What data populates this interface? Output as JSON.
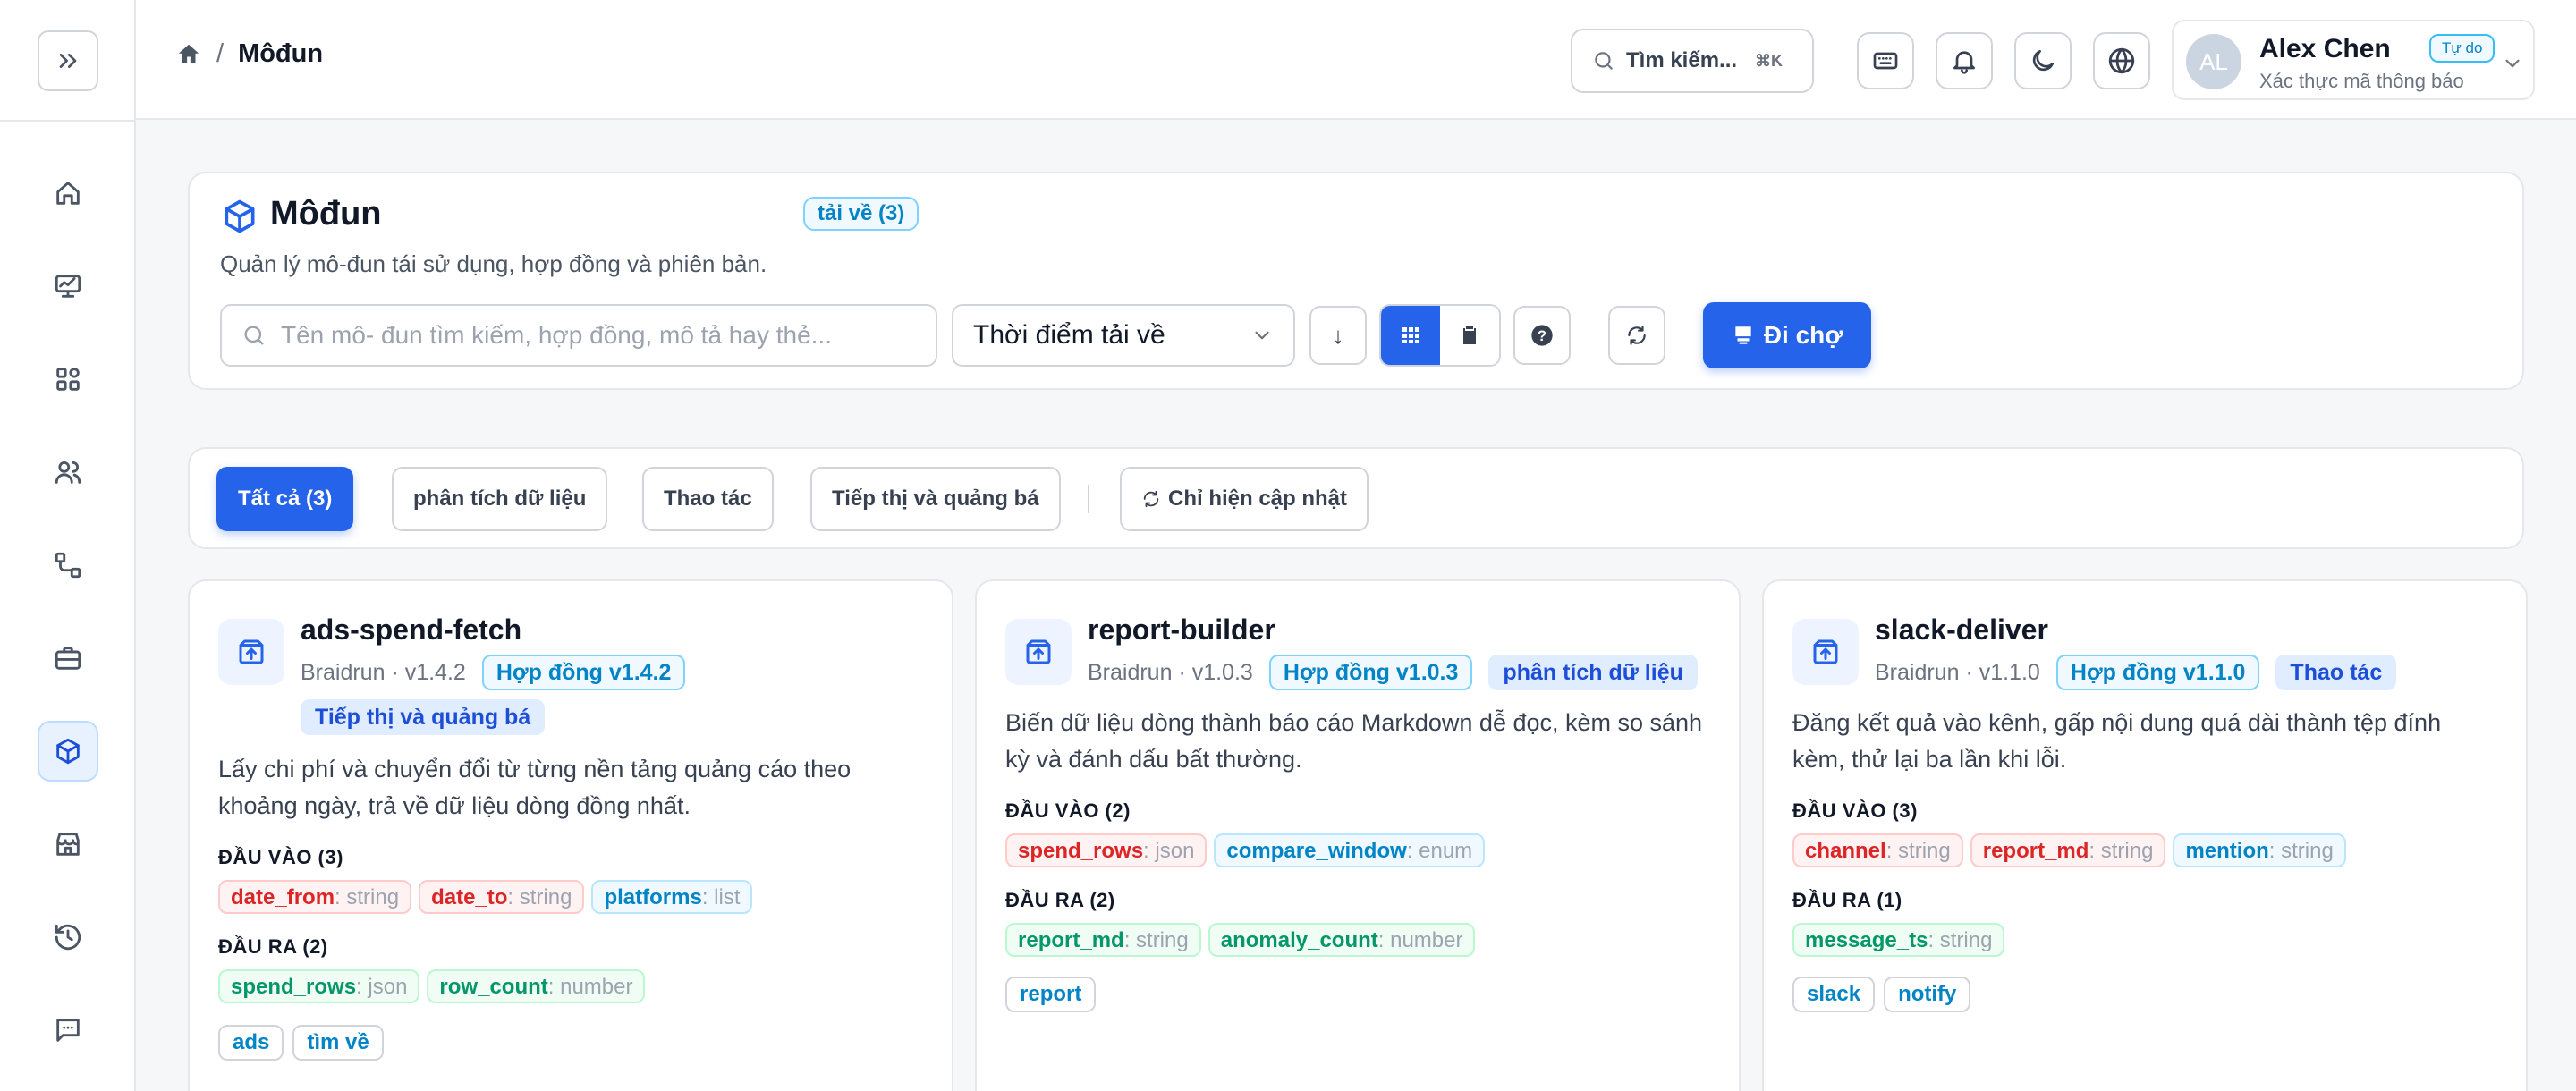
{
  "breadcrumb": {
    "current": "Môđun"
  },
  "topbar": {
    "search_label": "Tìm kiếm...",
    "search_shortcut": "⌘K",
    "icons": [
      "keyboard-icon",
      "bell-icon",
      "moon-icon",
      "globe-icon"
    ]
  },
  "user": {
    "initials": "AL",
    "name": "Alex Chen",
    "plan": "Tự do",
    "subtitle": "Xác thực mã thông báo"
  },
  "sidebar": {
    "items": [
      "home",
      "monitor",
      "apps",
      "users",
      "workflow",
      "briefcase",
      "modules",
      "store",
      "history",
      "messages"
    ],
    "active": "modules"
  },
  "header": {
    "title": "Môđun",
    "badge": "tải về (3)",
    "subtitle": "Quản lý mô-đun tái sử dụng, hợp đồng và phiên bản.",
    "search_placeholder": "Tên mô- đun tìm kiếm, hợp đồng, mô tả hay thẻ...",
    "sort_value": "Thời điểm tải về",
    "sort_dir_glyph": "↓",
    "help_glyph": "?",
    "market_label": "Đi chợ"
  },
  "filters": {
    "chips": [
      "Tất cả (3)",
      "phân tích dữ liệu",
      "Thao tác",
      "Tiếp thị và quảng bá"
    ],
    "active_index": 0,
    "update_only": "Chỉ hiện cập nhật"
  },
  "labels": {
    "inputs": "ĐẦU VÀO",
    "outputs": "ĐẦU RA"
  },
  "modules": [
    {
      "name": "ads-spend-fetch",
      "meta": "Braidrun · v1.4.2",
      "contract": "Hợp đồng v1.4.2",
      "category": "Tiếp thị và quảng bá",
      "description": "Lấy chi phí và chuyển đổi từ từng nền tảng quảng cáo theo khoảng ngày, trả về dữ liệu dòng đồng nhất.",
      "inputs_title": "ĐẦU VÀO (3)",
      "inputs": [
        {
          "name": "date_from",
          "type": ": string"
        },
        {
          "name": "date_to",
          "type": ": string"
        },
        {
          "name": "platforms",
          "type": ": list"
        }
      ],
      "outputs_title": "ĐẦU RA (2)",
      "outputs": [
        {
          "name": "spend_rows",
          "type": ": json"
        },
        {
          "name": "row_count",
          "type": ": number"
        }
      ],
      "tags": [
        "ads",
        "tìm về"
      ]
    },
    {
      "name": "report-builder",
      "meta": "Braidrun · v1.0.3",
      "contract": "Hợp đồng v1.0.3",
      "category": "phân tích dữ liệu",
      "description": "Biến dữ liệu dòng thành báo cáo Markdown dễ đọc, kèm so sánh kỳ và đánh dấu bất thường.",
      "inputs_title": "ĐẦU VÀO (2)",
      "inputs": [
        {
          "name": "spend_rows",
          "type": ": json"
        },
        {
          "name": "compare_window",
          "type": ": enum"
        }
      ],
      "outputs_title": "ĐẦU RA (2)",
      "outputs": [
        {
          "name": "report_md",
          "type": ": string"
        },
        {
          "name": "anomaly_count",
          "type": ": number"
        }
      ],
      "tags": [
        "report"
      ]
    },
    {
      "name": "slack-deliver",
      "meta": "Braidrun · v1.1.0",
      "contract": "Hợp đồng v1.1.0",
      "category": "Thao tác",
      "description": "Đăng kết quả vào kênh, gấp nội dung quá dài thành tệp đính kèm, thử lại ba lần khi lỗi.",
      "inputs_title": "ĐẦU VÀO (3)",
      "inputs": [
        {
          "name": "channel",
          "type": ": string"
        },
        {
          "name": "report_md",
          "type": ": string"
        },
        {
          "name": "mention",
          "type": ": string"
        }
      ],
      "outputs_title": "ĐẦU RA (1)",
      "outputs": [
        {
          "name": "message_ts",
          "type": ": string"
        }
      ],
      "tags": [
        "slack",
        "notify"
      ]
    }
  ],
  "colors": {
    "accent": "#2563eb",
    "input_red": "#dc2626",
    "input_blue": "#0284c7",
    "output_green": "#059669"
  }
}
